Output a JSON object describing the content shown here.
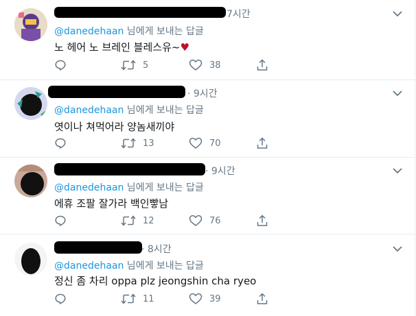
{
  "tweets": [
    {
      "time": "7시간",
      "reply_prefix": "@danedehaan",
      "reply_suffix": " 님에게 보내는 답글",
      "text": "노 헤어 노 브레인 블레스유~",
      "emoji": "♥",
      "replies": "",
      "retweets": "5",
      "likes": "38"
    },
    {
      "time": "· 9시간",
      "reply_prefix": "@danedehaan",
      "reply_suffix": " 님에게 보내는 답글",
      "text": "엿이나 쳐먹어라 양놈새끼야",
      "replies": "",
      "retweets": "13",
      "likes": "70"
    },
    {
      "time": "· 9시간",
      "reply_prefix": "@danedehaan",
      "reply_suffix": " 님에게 보내는 답글",
      "text": "에휴 조팔 잘가라 백인빻남",
      "replies": "",
      "retweets": "12",
      "likes": "76"
    },
    {
      "time": "· 8시간",
      "reply_prefix": "@danedehaan",
      "reply_suffix": " 님에게 보내는 답글",
      "text": "정신 좀 차리 oppa plz jeongshin cha ryeo",
      "replies": "",
      "retweets": "11",
      "likes": "39"
    }
  ],
  "colors": {
    "link": "#1b95e0",
    "muted": "#657786",
    "text": "#14171a",
    "border": "#e6ecf0",
    "heart": "#c0102a"
  },
  "icons": [
    "reply-icon",
    "retweet-icon",
    "like-icon",
    "share-icon",
    "caret-down-icon"
  ]
}
